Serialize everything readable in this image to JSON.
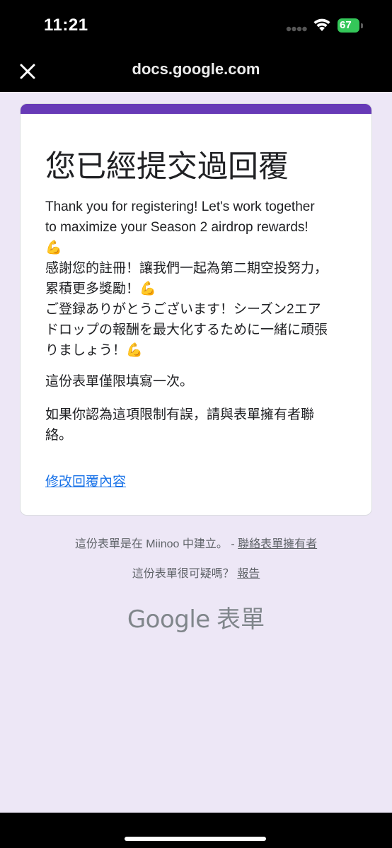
{
  "status_bar": {
    "time": "11:21",
    "battery": "67"
  },
  "nav": {
    "title": "docs.google.com"
  },
  "card": {
    "title": "您已經提交過回覆",
    "message_lines": [
      "Thank you for registering! Let's work together",
      "to maximize your Season 2 airdrop rewards!",
      "💪",
      "感謝您的註冊！讓我們一起為第二期空投努力，",
      "累積更多獎勵！💪",
      "ご登録ありがとうございます！シーズン2エア",
      "ドロップの報酬を最大化するために一緒に頑張",
      "りましょう！💪"
    ],
    "single_response_text": "這份表單僅限填寫一次。",
    "contact_lines": [
      "如果你認為這項限制有誤，請與表單擁有者聯",
      "絡。"
    ],
    "edit_link": "修改回覆內容"
  },
  "footer": {
    "created_text": "這份表單是在 Miinoo 中建立。 - ",
    "contact_owner_link": "聯絡表單擁有者",
    "suspicious_text": "這份表單很可疑嗎？ ",
    "report_link": "報告",
    "logo_google": "Google",
    "logo_forms": "表單"
  },
  "colors": {
    "accent": "#673ab7",
    "background": "#ede7f6",
    "link": "#1a73e8",
    "battery": "#34c759"
  }
}
